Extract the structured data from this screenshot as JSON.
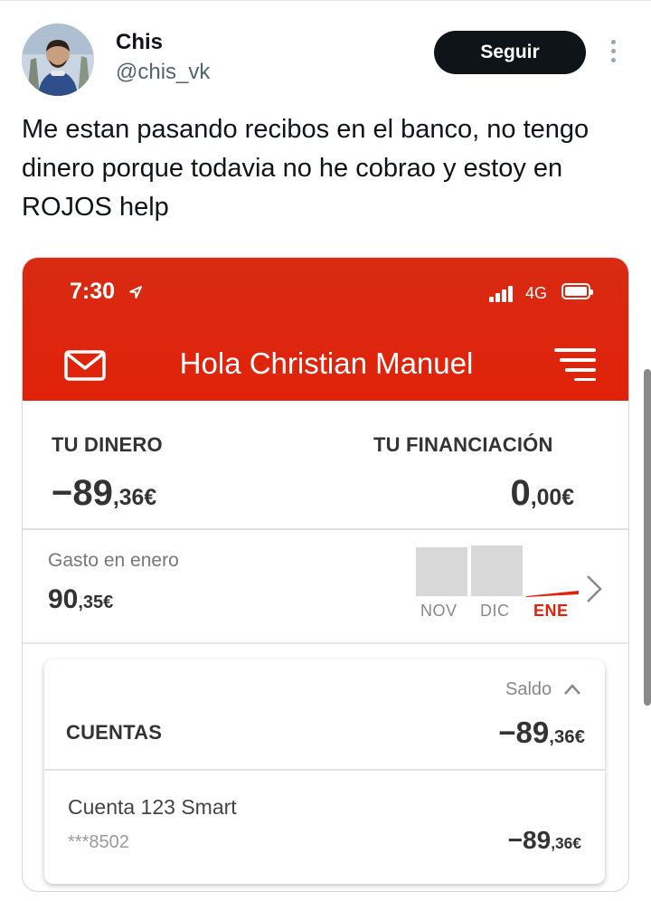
{
  "tweet": {
    "author_name": "Chis",
    "author_handle": "@chis_vk",
    "follow_label": "Seguir",
    "text": "Me estan pasando recibos en el banco, no tengo dinero porque todavia no he cobrao y estoy en ROJOS help"
  },
  "phone": {
    "status_bar": {
      "time": "7:30",
      "network": "4G"
    },
    "header": {
      "greeting": "Hola Christian Manuel"
    },
    "summary": {
      "money_label": "TU DINERO",
      "money_int": "−89",
      "money_dec": ",36€",
      "financing_label": "TU FINANCIACIÓN",
      "financing_int": "0",
      "financing_dec": ",00€"
    },
    "spending": {
      "label": "Gasto en enero",
      "amount_int": "90",
      "amount_dec": ",35€",
      "months": [
        "NOV",
        "DIC",
        "ENE"
      ]
    },
    "accounts": {
      "balance_label": "Saldo",
      "title": "CUENTAS",
      "total_int": "−89",
      "total_dec": ",36€",
      "items": [
        {
          "name": "Cuenta 123 Smart",
          "number": "***8502",
          "amount_int": "−89",
          "amount_dec": ",36€"
        }
      ]
    },
    "colors": {
      "brand_red": "#e1220a",
      "chart_bar": "#d8d8d8"
    }
  }
}
